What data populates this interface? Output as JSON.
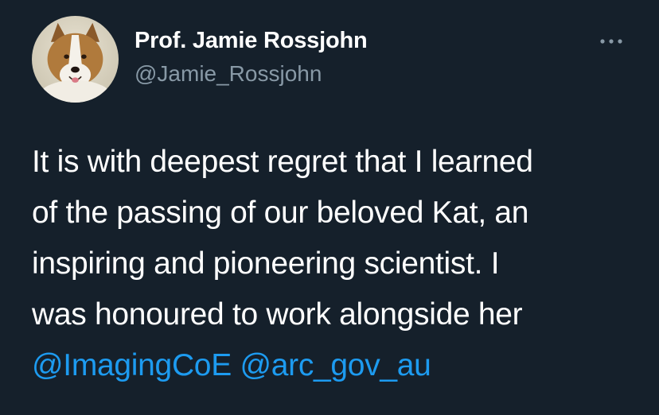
{
  "author": {
    "display_name": "Prof. Jamie Rossjohn",
    "handle": "@Jamie_Rossjohn",
    "avatar_icon": "dog-avatar"
  },
  "header": {
    "more_icon": "more-horizontal-icon"
  },
  "tweet": {
    "lines": [
      "It is with deepest regret that I learned",
      "of the passing of our beloved Kat, an",
      "inspiring and pioneering scientist. I",
      "was honoured to work alongside her"
    ],
    "mentions": [
      "@ImagingCoE",
      "@arc_gov_au"
    ]
  },
  "colors": {
    "background": "#15202b",
    "text": "#ffffff",
    "secondary_text": "#8899a6",
    "link": "#1d9bf0"
  }
}
